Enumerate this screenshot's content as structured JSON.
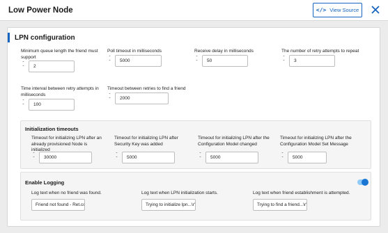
{
  "header": {
    "title": "Low Power Node",
    "view_source_label": "View Source",
    "view_source_icon": "code-icon",
    "close_icon": "close-icon"
  },
  "lpn": {
    "title": "LPN configuration",
    "fields": [
      {
        "label": "Minimum queue length the friend must support",
        "value": "2"
      },
      {
        "label": "Poll timeout in milliseconds",
        "value": "5000"
      },
      {
        "label": "Receive delay in milliseconds",
        "value": "50"
      },
      {
        "label": "The number of retry attempts to repeat",
        "value": "3"
      },
      {
        "label": "Time interval between retry attempts in milliseconds",
        "value": "100"
      },
      {
        "label": "Timeout between retries to find a friend",
        "value": "2000"
      }
    ]
  },
  "init_timeouts": {
    "title": "Initialization timeouts",
    "fields": [
      {
        "label": "Timeout for initializing LPN after an already provisioned Node is initialized",
        "value": "30000"
      },
      {
        "label": "Timeout for initializing LPN after Security Key was added",
        "value": "5000"
      },
      {
        "label": "Timeout for initializing LPN after the Configuration Model changed",
        "value": "5000"
      },
      {
        "label": "Timeout for initializing LPN after the Configuration Model Set Message",
        "value": "5000"
      }
    ]
  },
  "logging": {
    "title": "Enable Logging",
    "enabled": true,
    "accent": "#1976d2",
    "fields": [
      {
        "label": "Log text when no friend was found.",
        "value": "Friend not found - Ret.cod"
      },
      {
        "label": "Log text when LPN initialization starts.",
        "value": "Trying to initialize lpn...\\r\""
      },
      {
        "label": "Log text when friend establishment is attempted.",
        "value": "Trying to find a friend...\\r\""
      }
    ]
  }
}
